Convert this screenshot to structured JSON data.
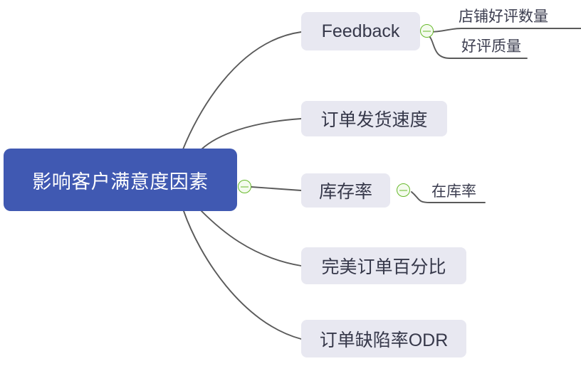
{
  "document": {
    "type": "mind-map",
    "background_color": "#ffffff"
  },
  "theme": {
    "root_fill": "#4059b2",
    "root_text": "#ffffff",
    "branch_fill": "#e8e8f1",
    "branch_text": "#36384a",
    "leaf_text": "#3c3e50",
    "edge_color": "#5a5a5a",
    "toggle_color": "#67b92b"
  },
  "root": {
    "label": "影响客户满意度因素",
    "toggle": "collapse-toggle"
  },
  "branches": [
    {
      "id": "feedback",
      "label": "Feedback",
      "toggle": "collapse-toggle",
      "children": [
        {
          "id": "shop-positive-count",
          "label": "店铺好评数量"
        },
        {
          "id": "positive-quality",
          "label": "好评质量"
        }
      ]
    },
    {
      "id": "order-shipping-speed",
      "label": "订单发货速度",
      "children": []
    },
    {
      "id": "inventory-rate",
      "label": "库存率",
      "toggle": "collapse-toggle",
      "children": [
        {
          "id": "in-stock-rate",
          "label": "在库率"
        }
      ]
    },
    {
      "id": "perfect-order-percentage",
      "label": "完美订单百分比",
      "children": []
    },
    {
      "id": "order-defect-rate",
      "label": "订单缺陷率ODR",
      "children": []
    }
  ]
}
